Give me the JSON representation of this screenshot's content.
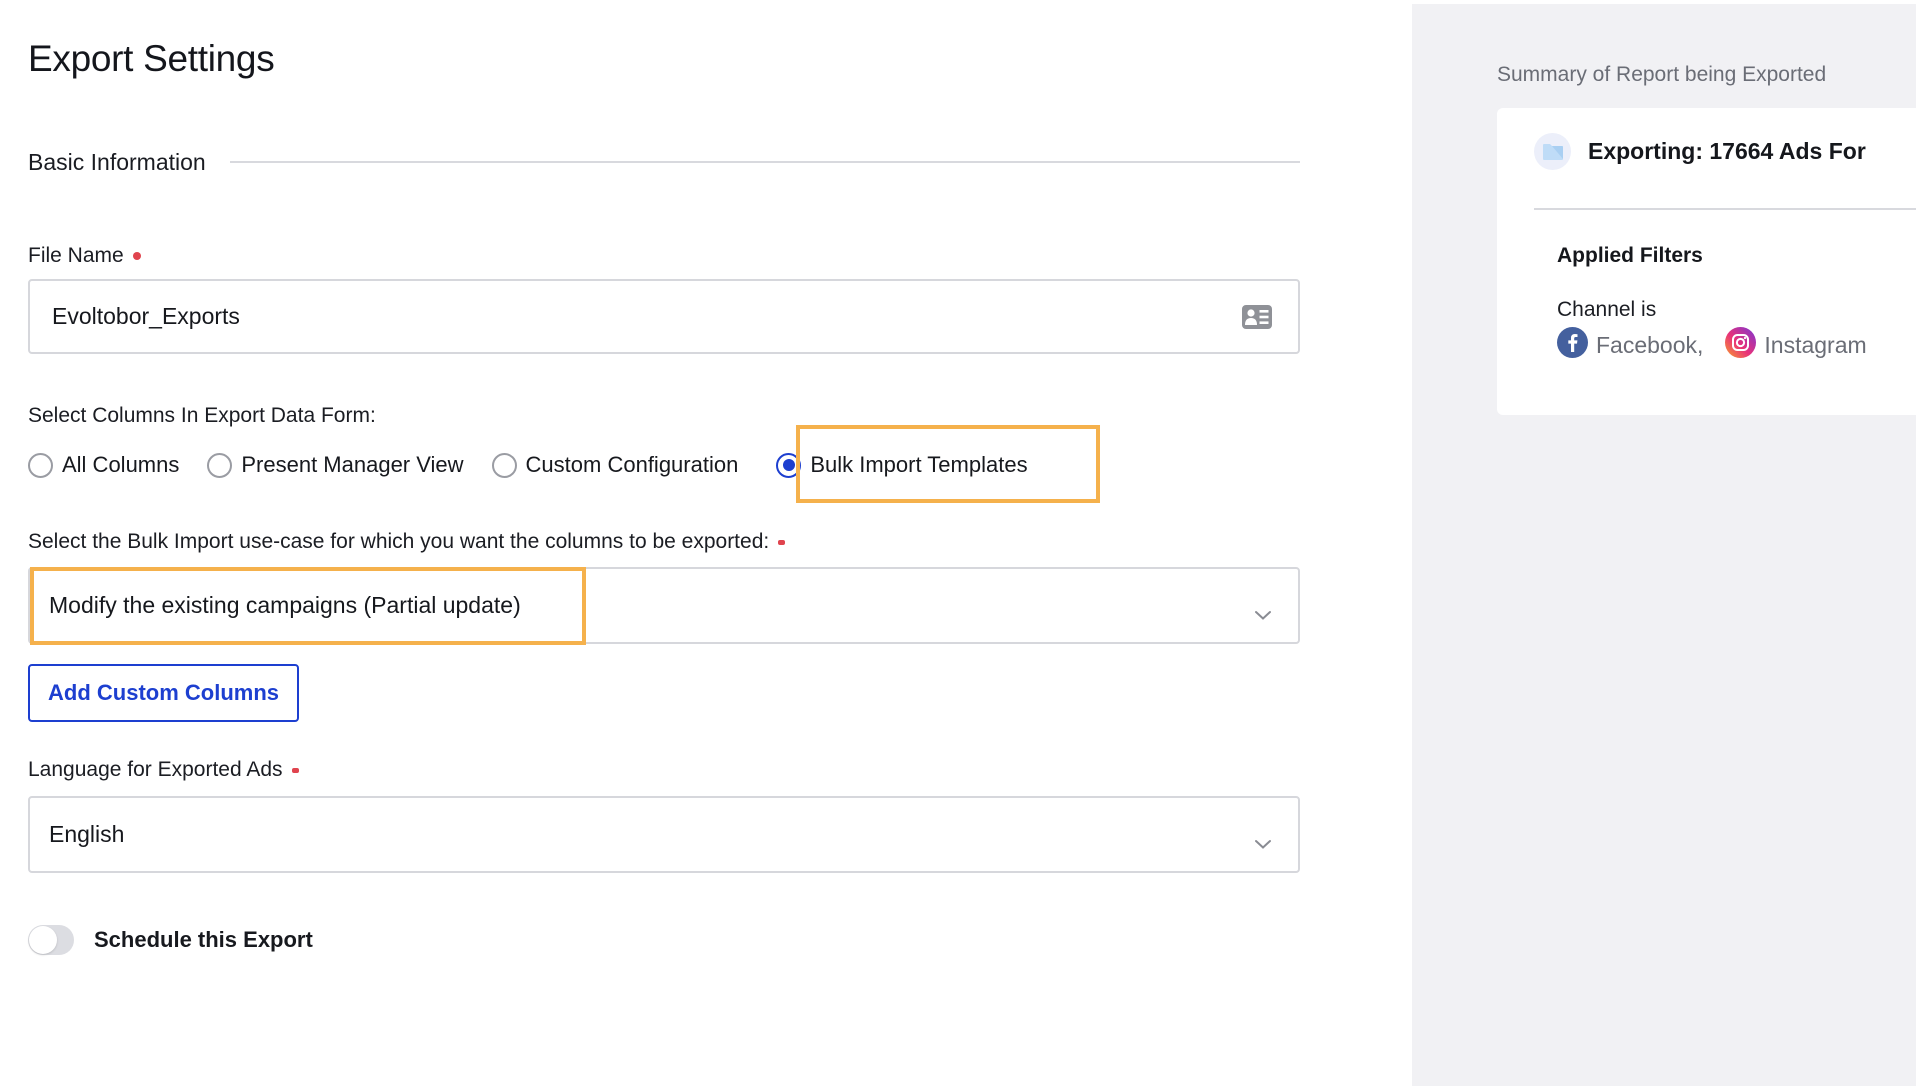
{
  "page": {
    "title": "Export Settings"
  },
  "basic_info": {
    "section_title": "Basic Information",
    "file_name": {
      "label": "File Name",
      "value": "Evoltobor_Exports",
      "icon": "contact-card-icon"
    },
    "columns": {
      "label": "Select Columns In Export Data Form:",
      "options": [
        {
          "label": "All Columns",
          "checked": false
        },
        {
          "label": "Present Manager View",
          "checked": false
        },
        {
          "label": "Custom Configuration",
          "checked": false
        },
        {
          "label": "Bulk Import Templates",
          "checked": true
        }
      ]
    },
    "use_case": {
      "label": "Select the Bulk Import use-case for which you want the columns to be exported:",
      "selected": "Modify the existing campaigns (Partial update)"
    },
    "add_custom_columns_label": "Add Custom Columns",
    "language": {
      "label": "Language for Exported Ads",
      "selected": "English"
    },
    "schedule": {
      "label": "Schedule this Export",
      "enabled": false
    }
  },
  "summary": {
    "label": "Summary of Report being Exported",
    "card_title": "Exporting: 17664 Ads For",
    "filters_title": "Applied Filters",
    "channel_label": "Channel is",
    "channels": [
      {
        "name": "Facebook,",
        "icon": "facebook-icon"
      },
      {
        "name": "Instagram",
        "icon": "instagram-icon"
      }
    ]
  },
  "colors": {
    "accent": "#1d3fd0",
    "highlight": "#f5b14c",
    "required": "#e0444e",
    "panel_bg": "#f1f1f4",
    "facebook": "#3b5998"
  }
}
